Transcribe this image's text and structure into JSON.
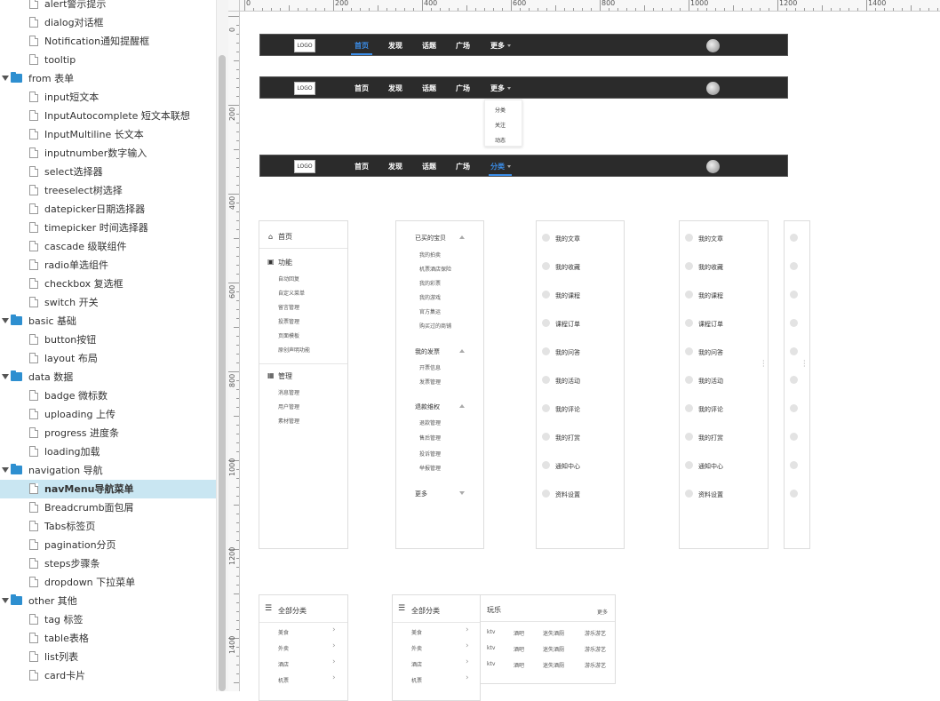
{
  "sidebar": {
    "rows": [
      {
        "type": "file",
        "label": "alert警示提示"
      },
      {
        "type": "file",
        "label": "dialog对话框"
      },
      {
        "type": "file",
        "label": "Notification通知提醒框"
      },
      {
        "type": "file",
        "label": "tooltip"
      },
      {
        "type": "folder",
        "label": "from 表单"
      },
      {
        "type": "file",
        "label": "input短文本"
      },
      {
        "type": "file",
        "label": "InputAutocomplete 短文本联想"
      },
      {
        "type": "file",
        "label": "InputMultiline 长文本"
      },
      {
        "type": "file",
        "label": "inputnumber数字输入"
      },
      {
        "type": "file",
        "label": "select选择器"
      },
      {
        "type": "file",
        "label": "treeselect树选择"
      },
      {
        "type": "file",
        "label": "datepicker日期选择器"
      },
      {
        "type": "file",
        "label": "timepicker 时间选择器"
      },
      {
        "type": "file",
        "label": "cascade 级联组件"
      },
      {
        "type": "file",
        "label": "radio单选组件"
      },
      {
        "type": "file",
        "label": "checkbox 复选框"
      },
      {
        "type": "file",
        "label": "switch 开关"
      },
      {
        "type": "folder",
        "label": "basic 基础"
      },
      {
        "type": "file",
        "label": "button按钮"
      },
      {
        "type": "file",
        "label": "layout 布局"
      },
      {
        "type": "folder",
        "label": "data 数据"
      },
      {
        "type": "file",
        "label": "badge 微标数"
      },
      {
        "type": "file",
        "label": "uploading 上传"
      },
      {
        "type": "file",
        "label": "progress 进度条"
      },
      {
        "type": "file",
        "label": "loading加载"
      },
      {
        "type": "folder",
        "label": "navigation 导航"
      },
      {
        "type": "file",
        "label": "navMenu导航菜单",
        "selected": true
      },
      {
        "type": "file",
        "label": "Breadcrumb面包屑"
      },
      {
        "type": "file",
        "label": "Tabs标签页"
      },
      {
        "type": "file",
        "label": "pagination分页"
      },
      {
        "type": "file",
        "label": "steps步骤条"
      },
      {
        "type": "file",
        "label": "dropdown 下拉菜单"
      },
      {
        "type": "folder",
        "label": "other 其他"
      },
      {
        "type": "file",
        "label": "tag 标签"
      },
      {
        "type": "file",
        "label": "table表格"
      },
      {
        "type": "file",
        "label": "list列表"
      },
      {
        "type": "file",
        "label": "card卡片"
      }
    ]
  },
  "rulers": {
    "top_labels": [
      "0",
      "200",
      "400",
      "600",
      "800",
      "1000",
      "1200",
      "1400"
    ],
    "left_labels": [
      "0",
      "200",
      "400",
      "600",
      "800",
      "1000",
      "1200",
      "1400"
    ]
  },
  "navbar": {
    "logo": "LOGO",
    "items": [
      "首页",
      "发现",
      "话题",
      "广场",
      "更多"
    ],
    "items3": [
      "首页",
      "发现",
      "话题",
      "广场",
      "分类"
    ]
  },
  "dropdown": {
    "items": [
      "分类",
      "关注",
      "动态"
    ]
  },
  "panel1": {
    "home": "首页",
    "func_title": "功能",
    "func_items": [
      "自动回复",
      "自定义菜单",
      "留言管理",
      "投票管理",
      "页面模板",
      "原创声明功能"
    ],
    "manage_title": "管理",
    "manage_items": [
      "消息管理",
      "用户管理",
      "素材管理"
    ]
  },
  "panel2": {
    "g1_title": "已买的宝贝",
    "g1_items": [
      "我的拍卖",
      "机票酒店保险",
      "我的彩票",
      "我的游戏",
      "官方集运",
      "购买过的商铺"
    ],
    "g2_title": "我的发票",
    "g2_items": [
      "开票信息",
      "发票管理"
    ],
    "g3_title": "退款维权",
    "g3_items": [
      "退款管理",
      "售后管理",
      "投诉管理",
      "举报管理"
    ],
    "more": "更多"
  },
  "panel_list": {
    "items": [
      "我的文章",
      "我的收藏",
      "我的课程",
      "课程订单",
      "我的问答",
      "我的活动",
      "我的评论",
      "我的打赏",
      "通知中心",
      "资料设置"
    ]
  },
  "cat_panel1": {
    "title": "全部分类",
    "items": [
      "美食",
      "外卖",
      "酒店",
      "机票"
    ]
  },
  "cat_panel2": {
    "title": "全部分类",
    "items": [
      "美食",
      "外卖",
      "酒店",
      "机票"
    ],
    "sub_title": "玩乐",
    "sub_more": "更多",
    "grid": [
      [
        "ktv",
        "酒吧",
        "迷失酒厕",
        "游乐游艺"
      ],
      [
        "ktv",
        "酒吧",
        "迷失酒厕",
        "游乐游艺"
      ],
      [
        "ktv",
        "酒吧",
        "迷失酒厕",
        "游乐游艺"
      ]
    ]
  },
  "colors": {
    "navbar_bg": "#2b2b2b",
    "accent": "#3b8eea",
    "folder": "#2e8fd0",
    "selected_row": "#c9e6f2"
  }
}
